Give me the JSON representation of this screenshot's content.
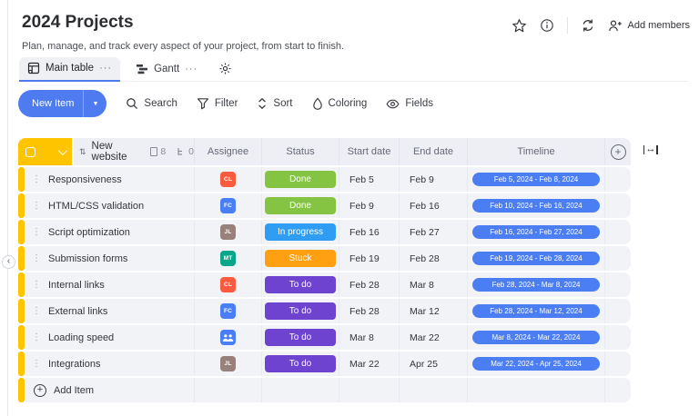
{
  "header": {
    "title": "2024 Projects",
    "subtitle": "Plan, manage, and track every aspect of your project, from start to finish.",
    "add_members_label": "Add members"
  },
  "tabs": {
    "main_table_label": "Main table",
    "gantt_label": "Gantt"
  },
  "toolbar": {
    "new_item_label": "New Item",
    "search_label": "Search",
    "filter_label": "Filter",
    "sort_label": "Sort",
    "coloring_label": "Coloring",
    "fields_label": "Fields"
  },
  "table": {
    "group": {
      "name": "New website",
      "file_count": "8",
      "subitem_count": "0"
    },
    "columns": {
      "assignee": "Assignee",
      "status": "Status",
      "start": "Start date",
      "end": "End date",
      "timeline": "Timeline"
    },
    "add_item_label": "Add Item",
    "rows": [
      {
        "task": "Responsiveness",
        "assignee": {
          "type": "initials",
          "initials": "CL",
          "color": "#fa5b3f"
        },
        "status": "Done",
        "start": "Feb 5",
        "end": "Feb 9",
        "timeline": "Feb 5, 2024 - Feb 8, 2024"
      },
      {
        "task": "HTML/CSS validation",
        "assignee": {
          "type": "initials",
          "initials": "FC",
          "color": "#4a7ef6"
        },
        "status": "Done",
        "start": "Feb 9",
        "end": "Feb 16",
        "timeline": "Feb 10, 2024 - Feb 16, 2024"
      },
      {
        "task": "Script optimization",
        "assignee": {
          "type": "initials",
          "initials": "JL",
          "color": "#97817a"
        },
        "status": "In progress",
        "start": "Feb 16",
        "end": "Feb 27",
        "timeline": "Feb 16, 2024 - Feb 27, 2024"
      },
      {
        "task": "Submission forms",
        "assignee": {
          "type": "initials",
          "initials": "MT",
          "color": "#0aa68a"
        },
        "status": "Stuck",
        "start": "Feb 19",
        "end": "Feb 28",
        "timeline": "Feb 19, 2024 - Feb 28, 2024"
      },
      {
        "task": "Internal links",
        "assignee": {
          "type": "initials",
          "initials": "CL",
          "color": "#fa5b3f"
        },
        "status": "To do",
        "start": "Feb 28",
        "end": "Mar 8",
        "timeline": "Feb 28, 2024 - Mar 8, 2024"
      },
      {
        "task": "External links",
        "assignee": {
          "type": "initials",
          "initials": "FC",
          "color": "#4a7ef6"
        },
        "status": "To do",
        "start": "Feb 28",
        "end": "Mar 12",
        "timeline": "Feb 28, 2024 - Mar 12, 2024"
      },
      {
        "task": "Loading speed",
        "assignee": {
          "type": "group",
          "initials": "",
          "color": "#4a7ef6"
        },
        "status": "To do",
        "start": "Mar 8",
        "end": "Mar 22",
        "timeline": "Mar 8, 2024 - Mar 22, 2024"
      },
      {
        "task": "Integrations",
        "assignee": {
          "type": "initials",
          "initials": "JL",
          "color": "#97817a"
        },
        "status": "To do",
        "start": "Mar 22",
        "end": "Apr 25",
        "timeline": "Mar 22, 2024 - Apr 25, 2024"
      }
    ]
  },
  "colors": {
    "group": "#ffc400",
    "timeline_pill": "#4c7ef3",
    "accent_blue": "#4e7cf0",
    "status": {
      "Done": "#85c442",
      "In progress": "#2f9df4",
      "Stuck": "#ffa012",
      "To do": "#6d43cf"
    }
  },
  "icons": {
    "dots": "⋮",
    "ellipsis": "···",
    "caret_down": "▼",
    "collapse": "‹",
    "gear": "⚙",
    "sort_handle": "⇅",
    "autofit_arrows": "↔",
    "plus": "+"
  }
}
